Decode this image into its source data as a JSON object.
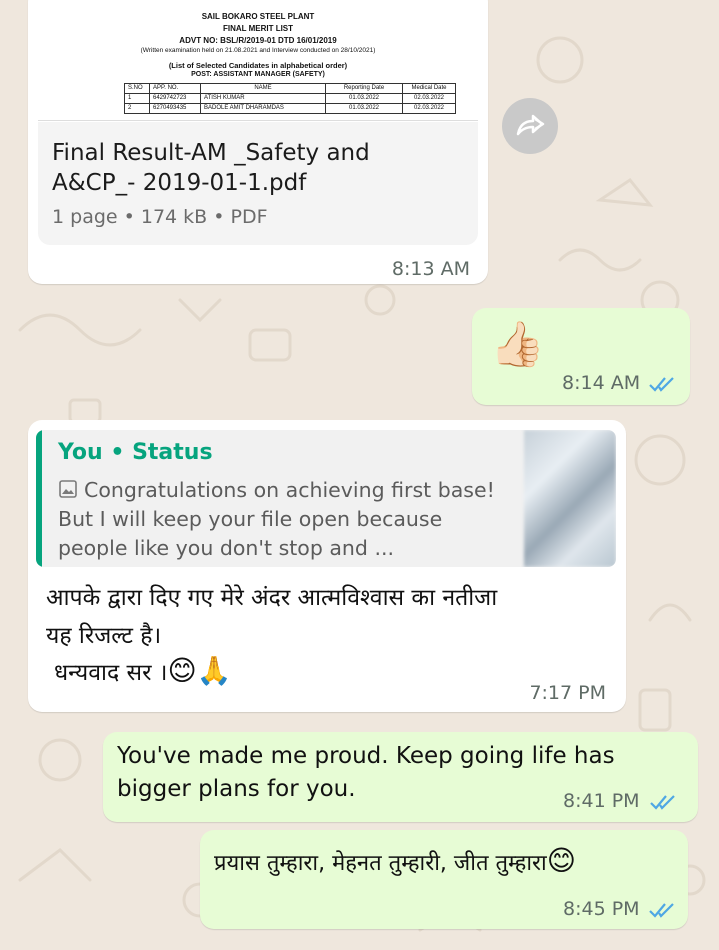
{
  "colors": {
    "wallpaper": "#efe7dd",
    "incoming_bubble": "#ffffff",
    "outgoing_bubble": "#e7fcd5",
    "accent_green": "#06a47e",
    "read_ticks": "#4fa7e4"
  },
  "messages": [
    {
      "direction": "incoming",
      "type": "document",
      "preview": {
        "line1": "SAIL BOKARO STEEL PLANT",
        "line2": "FINAL MERIT LIST",
        "line3": "ADVT NO: BSL/R/2019-01 DTD 16/01/2019",
        "line4": "(Written examination held on 21.08.2021 and Interview conducted on 28/10/2021)",
        "line5": "(List of Selected Candidates in alphabetical order)",
        "line6": "POST: ASSISTANT MANAGER (SAFETY)",
        "table_headers": [
          "S.NO",
          "APP. NO.",
          "NAME",
          "Reporting Date",
          "Medical Date"
        ],
        "table_rows": [
          [
            "1",
            "6429742723",
            "ATISH KUMAR",
            "01.03.2022",
            "02.03.2022"
          ],
          [
            "2",
            "6270493435",
            "BADOLE AMIT DHARAMDAS",
            "01.03.2022",
            "02.03.2022"
          ]
        ]
      },
      "file_name": "Final Result-AM _Safety and A&CP_- 2019-01-1.pdf",
      "meta": "1 page • 174 kB • PDF",
      "time": "8:13 AM",
      "forward_icon": "forward-icon"
    },
    {
      "direction": "outgoing",
      "type": "emoji",
      "text": "👍🏻",
      "time": "8:14 AM",
      "status_icon": "double-check-icon"
    },
    {
      "direction": "incoming",
      "type": "reply",
      "quote_author": "You • Status",
      "quote_text": "Congratulations on achieving first base! But I will keep your file open because people like you don't stop and ...",
      "line1": "आपके द्वारा दिए गए मेरे अंदर  आत्मविश्वास का नतीजा",
      "line2": "यह रिजल्ट है।",
      "line3": "धन्यवाद सर ।",
      "line3_emojis": "😊🙏",
      "time": "7:17 PM"
    },
    {
      "direction": "outgoing",
      "type": "text",
      "text": "You've made me proud. Keep going life has bigger plans for you.",
      "time": "8:41 PM",
      "status_icon": "double-check-icon"
    },
    {
      "direction": "outgoing",
      "type": "text",
      "text": "प्रयास तुम्हारा, मेहनत तुम्हारी, जीत तुम्हारा",
      "emoji": "😊",
      "time": "8:45 PM",
      "status_icon": "double-check-icon"
    }
  ]
}
